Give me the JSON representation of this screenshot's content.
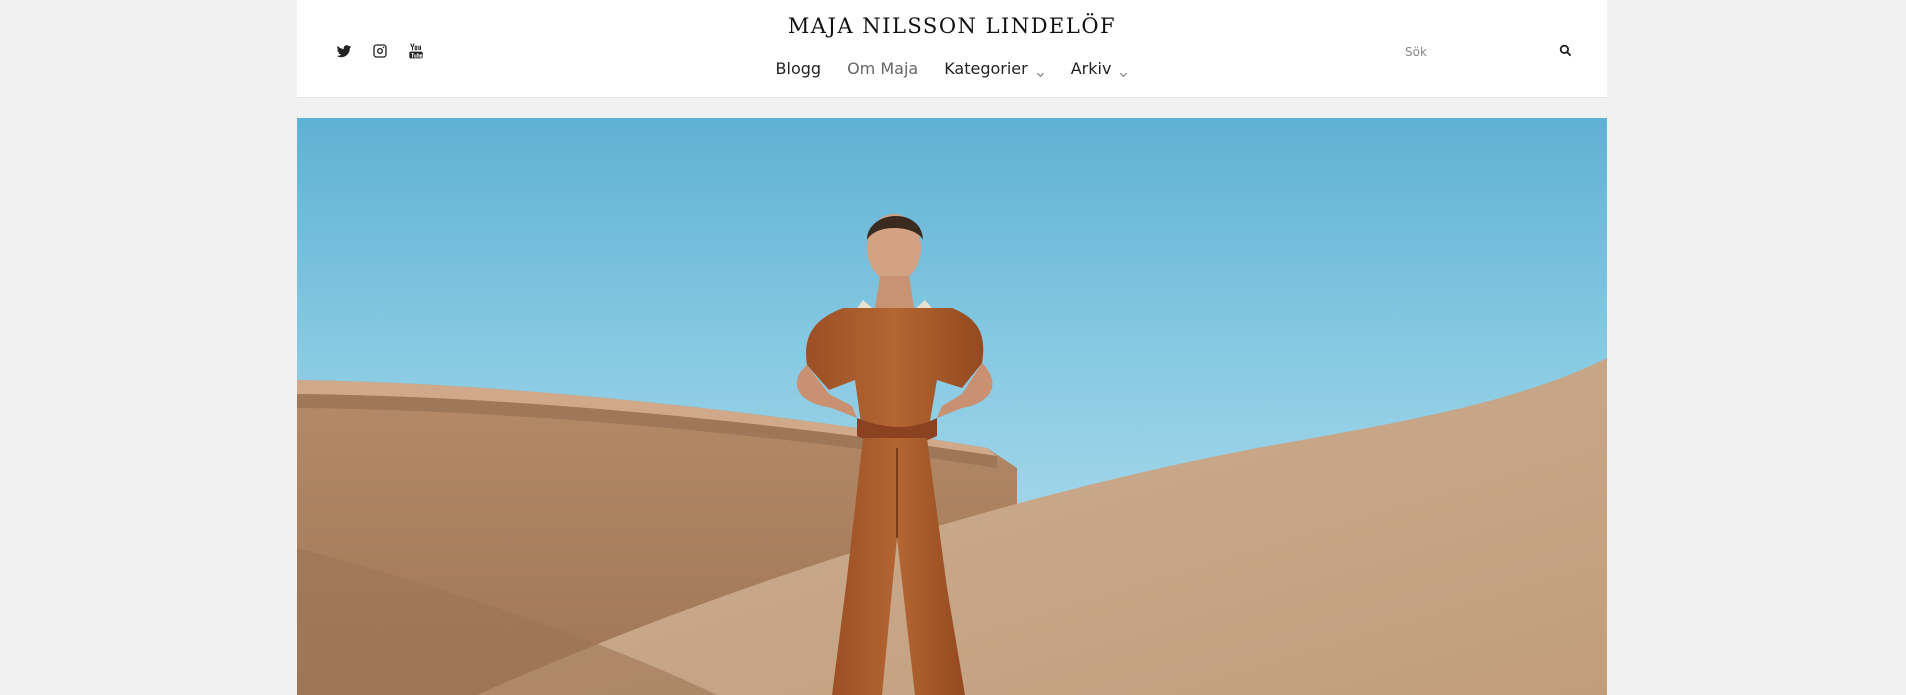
{
  "site": {
    "title": "MAJA NILSSON LINDELÖF"
  },
  "social": [
    {
      "name": "twitter-icon"
    },
    {
      "name": "instagram-icon"
    },
    {
      "name": "youtube-icon"
    }
  ],
  "nav": {
    "items": [
      {
        "label": "Blogg",
        "has_dropdown": false
      },
      {
        "label": "Om Maja",
        "has_dropdown": false
      },
      {
        "label": "Kategorier",
        "has_dropdown": true
      },
      {
        "label": "Arkiv",
        "has_dropdown": true
      }
    ]
  },
  "search": {
    "placeholder": "Sök",
    "value": ""
  },
  "colors": {
    "header_bg": "#ffffff",
    "page_bg": "#f1f1f1",
    "sky": "#7ec3df",
    "sand": "#c8a583",
    "jumpsuit": "#a9592b"
  }
}
